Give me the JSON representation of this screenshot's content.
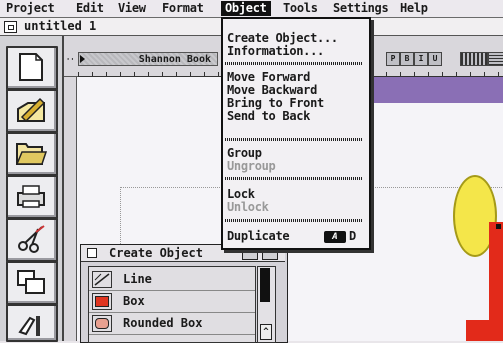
{
  "menubar": {
    "items": [
      "Project",
      "Edit",
      "View",
      "Format",
      "Object",
      "Tools",
      "Settings",
      "Help"
    ],
    "active": "Object"
  },
  "window": {
    "title": "untitled 1"
  },
  "ruler": {
    "style_name": "Shannon Book",
    "format_buttons": [
      "P",
      "B",
      "I",
      "U"
    ]
  },
  "object_menu": {
    "items": [
      {
        "label": "Create Object...",
        "enabled": true
      },
      {
        "label": "Information...",
        "enabled": true
      },
      {
        "label": "Move Forward",
        "enabled": true
      },
      {
        "label": "Move Backward",
        "enabled": true
      },
      {
        "label": "Bring to Front",
        "enabled": true
      },
      {
        "label": "Send to Back",
        "enabled": true
      },
      {
        "label": "Group",
        "enabled": true
      },
      {
        "label": "Ungroup",
        "enabled": false
      },
      {
        "label": "Lock",
        "enabled": true
      },
      {
        "label": "Unlock",
        "enabled": false
      },
      {
        "label": "Duplicate",
        "enabled": true
      }
    ],
    "duplicate_shortcut": {
      "modifier": "A",
      "key": "D"
    }
  },
  "palette": {
    "title": "Create Object",
    "items": [
      {
        "label": "Line",
        "icon": "line-icon"
      },
      {
        "label": "Box",
        "icon": "box-icon"
      },
      {
        "label": "Rounded Box",
        "icon": "rounded-box-icon"
      }
    ]
  },
  "toolbox": {
    "tools": [
      "new-page-icon",
      "pen-tool-icon",
      "open-folder-icon",
      "printer-icon",
      "scissors-icon",
      "copy-boxes-icon",
      "paste-hand-icon"
    ]
  },
  "colors": {
    "accent_purple": "#8a6fb5",
    "yellow_shape": "#f4e64a",
    "red_shape": "#e22a1a",
    "menu_highlight": "#111111"
  }
}
